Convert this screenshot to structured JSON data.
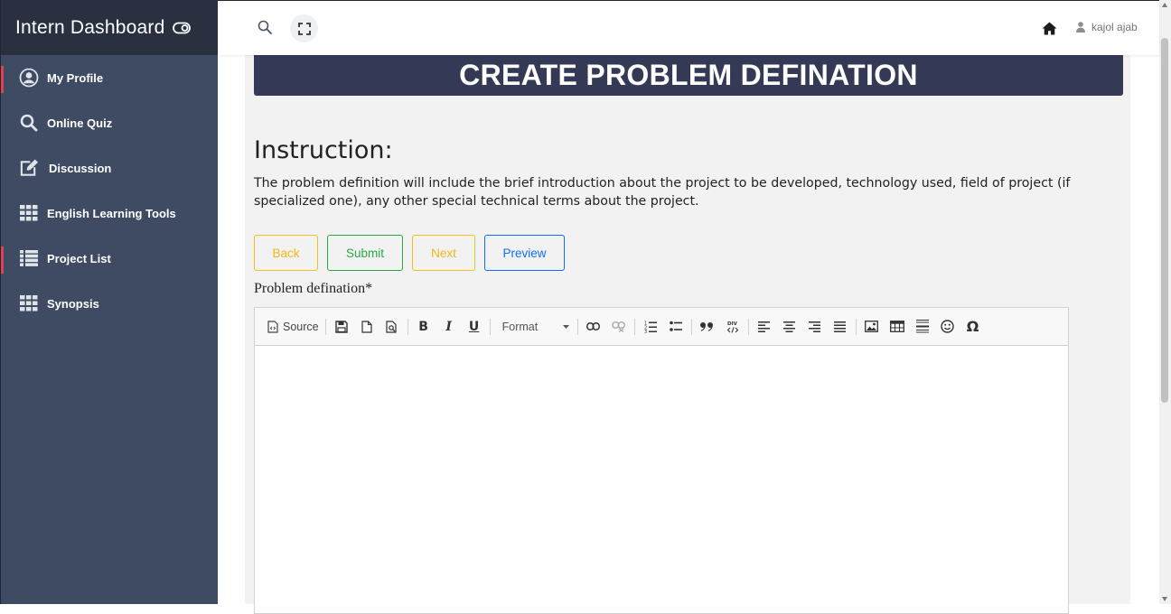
{
  "sidebar": {
    "brand": "Intern Dashboard",
    "items": [
      {
        "label": "My Profile",
        "icon": "user-circle-icon"
      },
      {
        "label": "Online Quiz",
        "icon": "search-icon"
      },
      {
        "label": "Discussion",
        "icon": "edit-icon"
      },
      {
        "label": "English Learning Tools",
        "icon": "grid-icon"
      },
      {
        "label": "Project List",
        "icon": "list-icon"
      },
      {
        "label": "Synopsis",
        "icon": "grid-icon"
      }
    ]
  },
  "topbar": {
    "user_name": "kajol ajab"
  },
  "main": {
    "title": "CREATE PROBLEM DEFINATION",
    "instruction_heading": "Instruction:",
    "instruction_text": "The problem definition will include the brief introduction about the project to be developed, technology used, field of project (if specialized one), any other special technical terms about the project.",
    "buttons": {
      "back": "Back",
      "submit": "Submit",
      "next": "Next",
      "preview": "Preview"
    },
    "field_label": "Problem defination*",
    "editor": {
      "source_label": "Source",
      "format_label": "Format"
    }
  },
  "colors": {
    "sidebar_bg": "#3f4b63",
    "brand_bg": "#2a3040",
    "title_bar_bg": "#343a56",
    "active_marker": "#e04050",
    "warning": "#f0b818",
    "success": "#28a745",
    "primary": "#0d6efd"
  }
}
